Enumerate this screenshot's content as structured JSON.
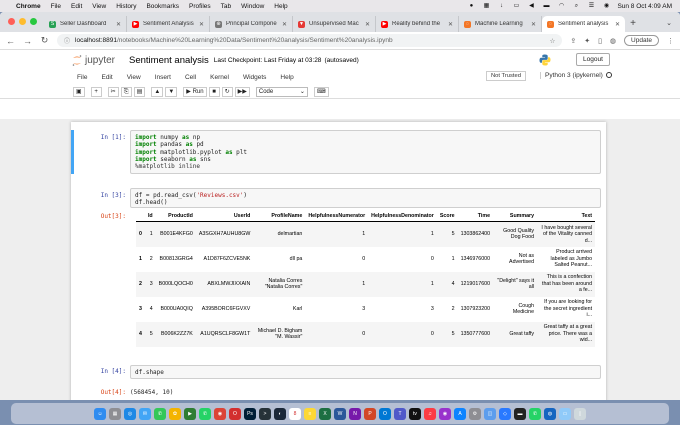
{
  "menubar": {
    "app": "Chrome",
    "items": [
      "File",
      "Edit",
      "View",
      "History",
      "Bookmarks",
      "Profiles",
      "Tab",
      "Window",
      "Help"
    ],
    "clock": "Sun 8 Oct  4:09 AM"
  },
  "tabs": [
    {
      "label": "Seller Dashboard",
      "color": "#27a155",
      "glyph": "S"
    },
    {
      "label": "Sentiment Analysis",
      "color": "#ff0000",
      "glyph": "▶"
    },
    {
      "label": "Principal Compone",
      "color": "#777777",
      "glyph": "⊕"
    },
    {
      "label": "Unsupervised Mac",
      "color": "#e53935",
      "glyph": "▼"
    },
    {
      "label": "Reality behind the",
      "color": "#ff0000",
      "glyph": "▶"
    },
    {
      "label": "Machine Learning",
      "color": "#f37626",
      "glyph": "◌"
    },
    {
      "label": "Sentiment analysis",
      "color": "#f37626",
      "glyph": "◌",
      "active": true
    }
  ],
  "address": {
    "host": "localhost:8891",
    "path": "/notebooks/Machine%20Learning%20Data/Sentiment%20analysis/Sentiment%20analysis.ipynb",
    "update_label": "Update"
  },
  "jupyter": {
    "brand": "jupyter",
    "notebook_title": "Sentiment analysis",
    "checkpoint": "Last Checkpoint: Last Friday at 03:28",
    "autosaved": "(autosaved)",
    "logout_label": "Logout",
    "menu": [
      "File",
      "Edit",
      "View",
      "Insert",
      "Cell",
      "Kernel",
      "Widgets",
      "Help"
    ],
    "trust_label": "Not Trusted",
    "kernel_label": "Python 3 (ipykernel)",
    "run_label": "Run",
    "celltype": "Code"
  },
  "cells": {
    "c1": {
      "prompt": "In [1]:",
      "lines": [
        [
          [
            "kw",
            "import"
          ],
          [
            "",
            " numpy "
          ],
          [
            "kw",
            "as"
          ],
          [
            "",
            " np"
          ]
        ],
        [
          [
            "kw",
            "import"
          ],
          [
            "",
            " pandas "
          ],
          [
            "kw",
            "as"
          ],
          [
            "",
            " pd"
          ]
        ],
        [
          [
            "kw",
            "import"
          ],
          [
            "",
            " matplotlib.pyplot "
          ],
          [
            "kw",
            "as"
          ],
          [
            "",
            " plt"
          ]
        ],
        [
          [
            "kw",
            "import"
          ],
          [
            "",
            " seaborn "
          ],
          [
            "kw",
            "as"
          ],
          [
            "",
            " sns"
          ]
        ],
        [
          [
            "mag",
            "%matplotlib inline"
          ]
        ]
      ]
    },
    "c3": {
      "prompt": "In [3]:",
      "out_prompt": "Out[3]:",
      "lines": [
        [
          [
            "",
            "df "
          ],
          [
            "",
            "= "
          ],
          [
            "",
            "pd.read_csv("
          ],
          [
            "str",
            "'Reviews.csv'"
          ],
          [
            "",
            ")"
          ]
        ],
        [
          [
            "",
            "df.head()"
          ]
        ]
      ]
    },
    "c4": {
      "prompt": "In [4]:",
      "out_prompt": "Out[4]:",
      "lines": [
        [
          [
            "",
            "df.shape"
          ]
        ]
      ],
      "output": "(568454, 10)"
    }
  },
  "dataframe": {
    "columns": [
      "",
      "Id",
      "ProductId",
      "UserId",
      "ProfileName",
      "HelpfulnessNumerator",
      "HelpfulnessDenominator",
      "Score",
      "Time",
      "Summary",
      "Text"
    ],
    "rows": [
      [
        "0",
        "1",
        "B001E4KFG0",
        "A3SGXH7AUHU8GW",
        "delmartian",
        "1",
        "1",
        "5",
        "1303862400",
        "Good Quality Dog Food",
        "I have bought several of the Vitality canned d..."
      ],
      [
        "1",
        "2",
        "B00813GRG4",
        "A1D87F6ZCVE5NK",
        "dll pa",
        "0",
        "0",
        "1",
        "1346976000",
        "Not as Advertised",
        "Product arrived labeled as Jumbo Salted Peanut..."
      ],
      [
        "2",
        "3",
        "B000LQOCH0",
        "ABXLMWJIXXAIN",
        "Natalia Corres \"Natalia Corres\"",
        "1",
        "1",
        "4",
        "1219017600",
        "\"Delight\" says it all",
        "This is a confection that has been around a fe..."
      ],
      [
        "3",
        "4",
        "B000UA0QIQ",
        "A395BORC6FGVXV",
        "Karl",
        "3",
        "3",
        "2",
        "1307923200",
        "Cough Medicine",
        "If you are looking for the secret ingredient i..."
      ],
      [
        "4",
        "5",
        "B006K2ZZ7K",
        "A1UQRSCLF8GW1T",
        "Michael D. Bigham \"M. Wassir\"",
        "0",
        "0",
        "5",
        "1350777600",
        "Great taffy",
        "Great taffy at a great price. There was a wid..."
      ]
    ]
  },
  "dock": {
    "icons": [
      {
        "name": "finder-icon",
        "color": "#2f8cf0",
        "glyph": "☺"
      },
      {
        "name": "launchpad-icon",
        "color": "#8e8e93",
        "glyph": "▦"
      },
      {
        "name": "safari-icon",
        "color": "#1e88e5",
        "glyph": "◎"
      },
      {
        "name": "mail-icon",
        "color": "#42a5f5",
        "glyph": "✉"
      },
      {
        "name": "messages-icon",
        "color": "#34c759",
        "glyph": "✆"
      },
      {
        "name": "photos-icon",
        "color": "#f4b400",
        "glyph": "✿"
      },
      {
        "name": "facetime-icon",
        "color": "#2e7d32",
        "glyph": "▶"
      },
      {
        "name": "whatsapp-icon",
        "color": "#25d366",
        "glyph": "✆"
      },
      {
        "name": "chrome-icon",
        "color": "#db4437",
        "glyph": "◉"
      },
      {
        "name": "opera-icon",
        "color": "#d32f2f",
        "glyph": "O"
      },
      {
        "name": "photoshop-icon",
        "color": "#001e36",
        "glyph": "Ps"
      },
      {
        "name": "terminal-icon",
        "color": "#263238",
        "glyph": ">"
      },
      {
        "name": "steam-icon",
        "color": "#1b2838",
        "glyph": "◐"
      },
      {
        "name": "calendar-icon",
        "color": "#ffffff",
        "glyph": "8"
      },
      {
        "name": "notes-icon",
        "color": "#fdd835",
        "glyph": "≡"
      },
      {
        "name": "excel-icon",
        "color": "#1d6f42",
        "glyph": "X"
      },
      {
        "name": "word-icon",
        "color": "#2b579a",
        "glyph": "W"
      },
      {
        "name": "onenote-icon",
        "color": "#7719aa",
        "glyph": "N"
      },
      {
        "name": "powerpoint-icon",
        "color": "#d24726",
        "glyph": "P"
      },
      {
        "name": "outlook-icon",
        "color": "#0078d4",
        "glyph": "O"
      },
      {
        "name": "teams-icon",
        "color": "#5059c9",
        "glyph": "T"
      },
      {
        "name": "appletv-icon",
        "color": "#111111",
        "glyph": "tv"
      },
      {
        "name": "music-icon",
        "color": "#fc3c44",
        "glyph": "♫"
      },
      {
        "name": "podcasts-icon",
        "color": "#9933cc",
        "glyph": "◉"
      },
      {
        "name": "appstore-icon",
        "color": "#0d84ff",
        "glyph": "A"
      },
      {
        "name": "settings-icon",
        "color": "#8e8e93",
        "glyph": "⚙"
      },
      {
        "name": "preview-icon",
        "color": "#5c9ded",
        "glyph": "◫"
      },
      {
        "name": "vscode-icon",
        "color": "#2979ff",
        "glyph": "◇"
      },
      {
        "name": "activity-icon",
        "color": "#222222",
        "glyph": "▬"
      },
      {
        "name": "whatsapp2-icon",
        "color": "#25d366",
        "glyph": "✆"
      },
      {
        "name": "globe-icon",
        "color": "#1565c0",
        "glyph": "◍"
      },
      {
        "name": "folder-icon",
        "color": "#90caf9",
        "glyph": "▭"
      },
      {
        "name": "trash-icon",
        "color": "#cfd8dc",
        "glyph": "▯"
      }
    ]
  }
}
